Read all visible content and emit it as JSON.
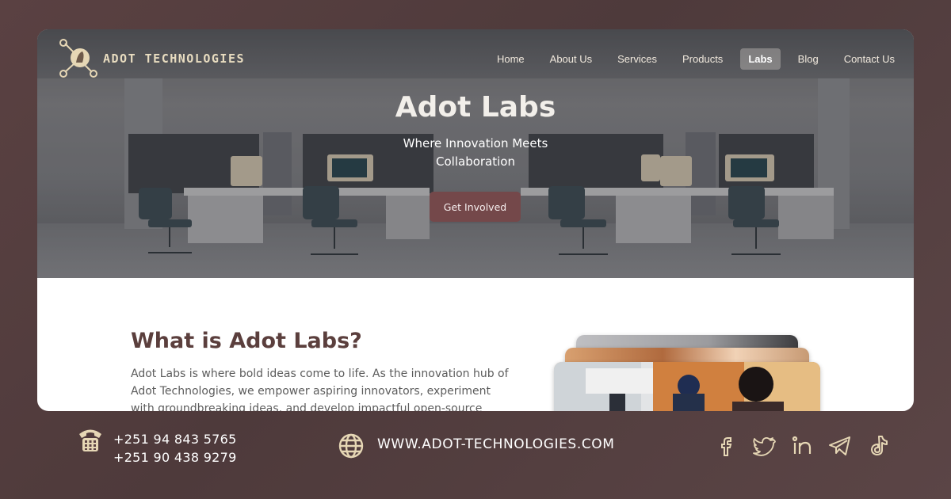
{
  "header": {
    "brand": "ADOT TECHNOLOGIES",
    "nav": [
      {
        "label": "Home",
        "active": false
      },
      {
        "label": "About Us",
        "active": false
      },
      {
        "label": "Services",
        "active": false
      },
      {
        "label": "Products",
        "active": false
      },
      {
        "label": "Labs",
        "active": true
      },
      {
        "label": "Blog",
        "active": false
      },
      {
        "label": "Contact Us",
        "active": false
      }
    ]
  },
  "hero": {
    "title": "Adot Labs",
    "subtitle": "Where Innovation Meets Collaboration",
    "cta_label": "Get Involved"
  },
  "content": {
    "title": "What is Adot Labs?",
    "body": "Adot Labs is where bold ideas come to life. As the innovation hub of Adot Technologies, we empower aspiring innovators, experiment with groundbreaking ideas, and develop impactful open-source projects."
  },
  "footer": {
    "phones": [
      "+251 94 843 5765",
      "+251 90 438 9279"
    ],
    "website": "WWW.ADOT-TECHNOLOGIES.COM",
    "socials": [
      "facebook-icon",
      "twitter-icon",
      "linkedin-icon",
      "telegram-icon",
      "tiktok-icon"
    ]
  },
  "colors": {
    "background": "#523d3e",
    "accent": "#74484a",
    "heading": "#5b3f3d",
    "icon": "#e6d7b5"
  }
}
